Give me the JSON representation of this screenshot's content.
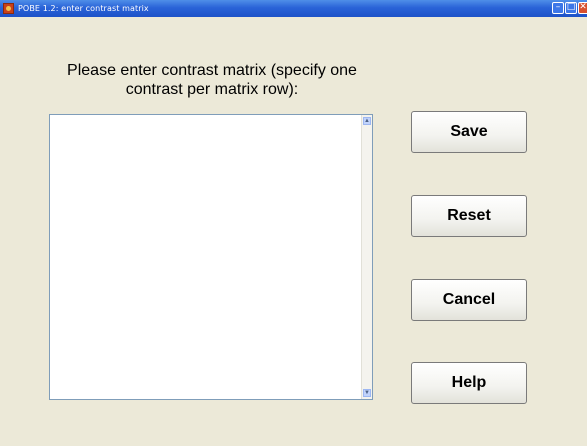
{
  "window": {
    "title": "POBE 1.2: enter contrast matrix",
    "controls": {
      "minimize": "–",
      "maximize": "□",
      "close": "✕"
    }
  },
  "prompt": {
    "line1": "Please enter contrast matrix (specify one",
    "line2": "contrast per matrix row):"
  },
  "matrix_input": {
    "value": ""
  },
  "buttons": {
    "save": "Save",
    "reset": "Reset",
    "cancel": "Cancel",
    "help": "Help"
  },
  "colors": {
    "background": "#ece9d8",
    "titlebar": "#2a63d8",
    "input_border": "#7f9db9"
  },
  "icons": {
    "app": "matlab-figure-icon",
    "scroll_up": "arrow-up-icon",
    "scroll_down": "arrow-down-icon"
  }
}
